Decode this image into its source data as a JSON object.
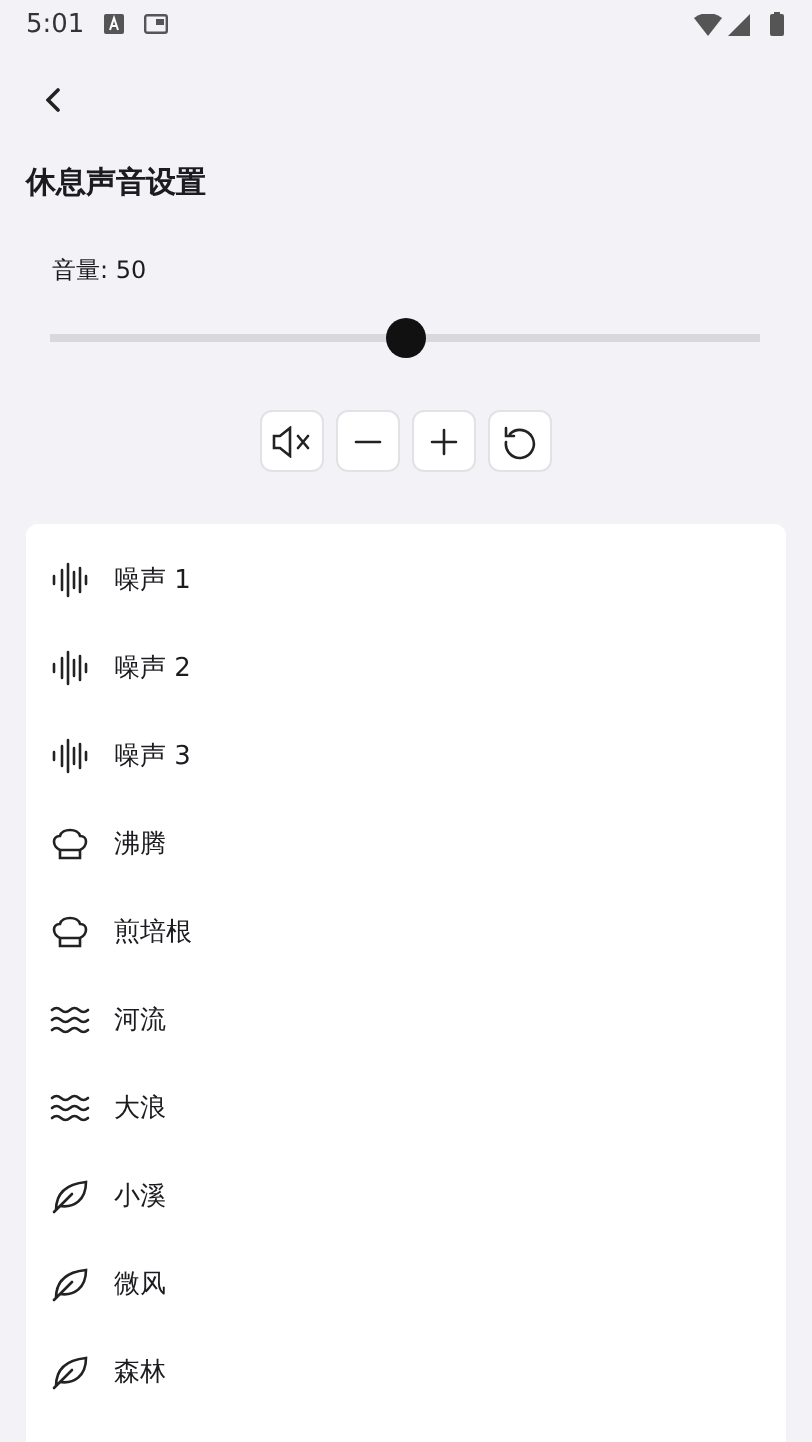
{
  "status_bar": {
    "time": "5:01"
  },
  "title": "休息声音设置",
  "volume": {
    "label": "音量: 50",
    "level": 0.5
  },
  "controls": [
    {
      "kind": "mute"
    },
    {
      "kind": "minus"
    },
    {
      "kind": "plus"
    },
    {
      "kind": "reset"
    }
  ],
  "sounds": [
    {
      "label": "噪声 1",
      "kind": "noise"
    },
    {
      "label": "噪声 2",
      "kind": "noise"
    },
    {
      "label": "噪声 3",
      "kind": "noise"
    },
    {
      "label": "沸腾",
      "kind": "boil"
    },
    {
      "label": "煎培根",
      "kind": "boil"
    },
    {
      "label": "河流",
      "kind": "water"
    },
    {
      "label": "大浪",
      "kind": "water"
    },
    {
      "label": "小溪",
      "kind": "leaf"
    },
    {
      "label": "微风",
      "kind": "leaf"
    },
    {
      "label": "森林",
      "kind": "leaf"
    }
  ]
}
